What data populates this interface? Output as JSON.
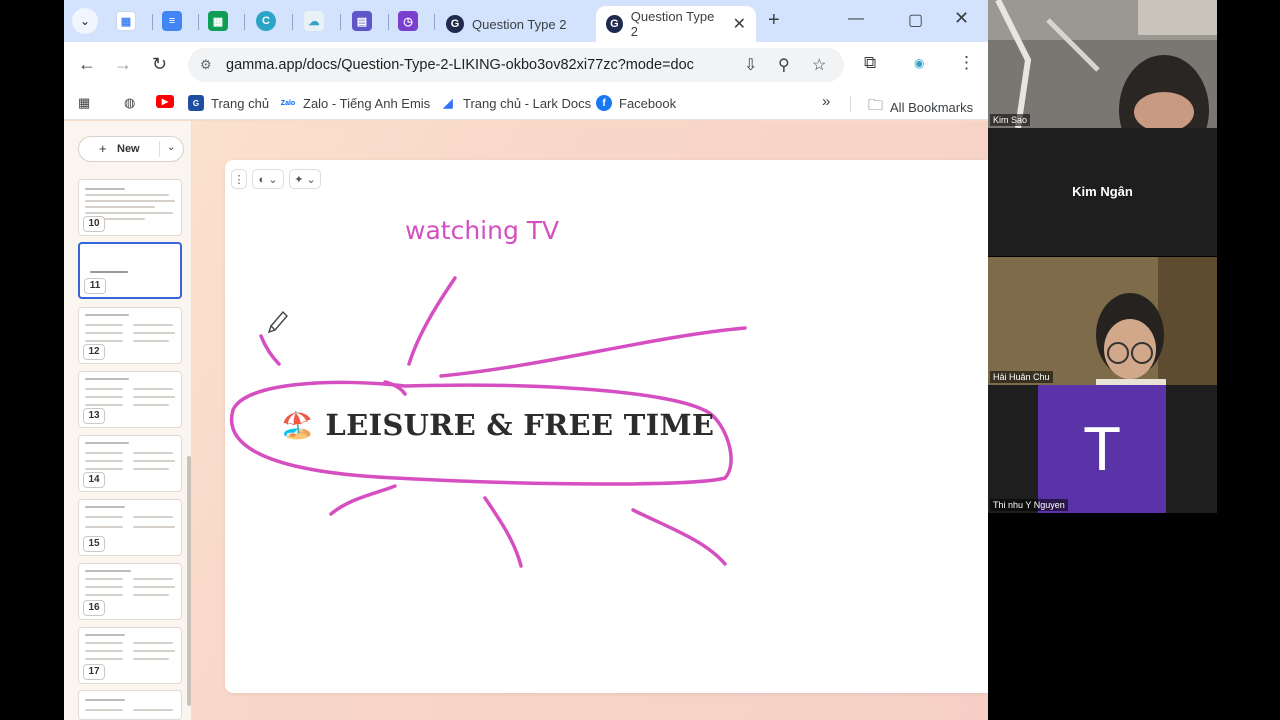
{
  "browser": {
    "tabs": [
      {
        "title": "Question Type 2",
        "active": false
      },
      {
        "title": "Question Type 2",
        "active": true
      }
    ],
    "url": "gamma.app/docs/Question-Type-2-LIKING-okbo3ov82xi77zc?mode=doc",
    "bookmarks": {
      "items": [
        {
          "label": "Trang chủ",
          "icon": "bookmark-icon-red"
        },
        {
          "label": "Zalo - Tiếng Anh Emis",
          "icon": "zalo-icon"
        },
        {
          "label": "Trang chủ - Lark Docs",
          "icon": "lark-icon"
        },
        {
          "label": "Facebook",
          "icon": "facebook-icon"
        }
      ],
      "more": "»",
      "all_bookmarks": "All Bookmarks"
    }
  },
  "gamma": {
    "new_button": "New",
    "thumbnails": [
      "10",
      "11",
      "12",
      "13",
      "14",
      "15",
      "16",
      "17"
    ],
    "active_thumbnail": "11",
    "card_title": "LEISURE & FREE TIME",
    "card_title_emoji": "🏖️",
    "handwritten_label": "watching TV",
    "ink_color": "#d54fc1"
  },
  "video_call": {
    "participants": [
      {
        "name": "Kim Sao"
      },
      {
        "name": "Kim Ngân"
      },
      {
        "name": "Hải Huân Chu"
      },
      {
        "name": "Thi nhu Y Nguyen",
        "initial": "T"
      }
    ],
    "avatar_color": "#5b33a8"
  }
}
